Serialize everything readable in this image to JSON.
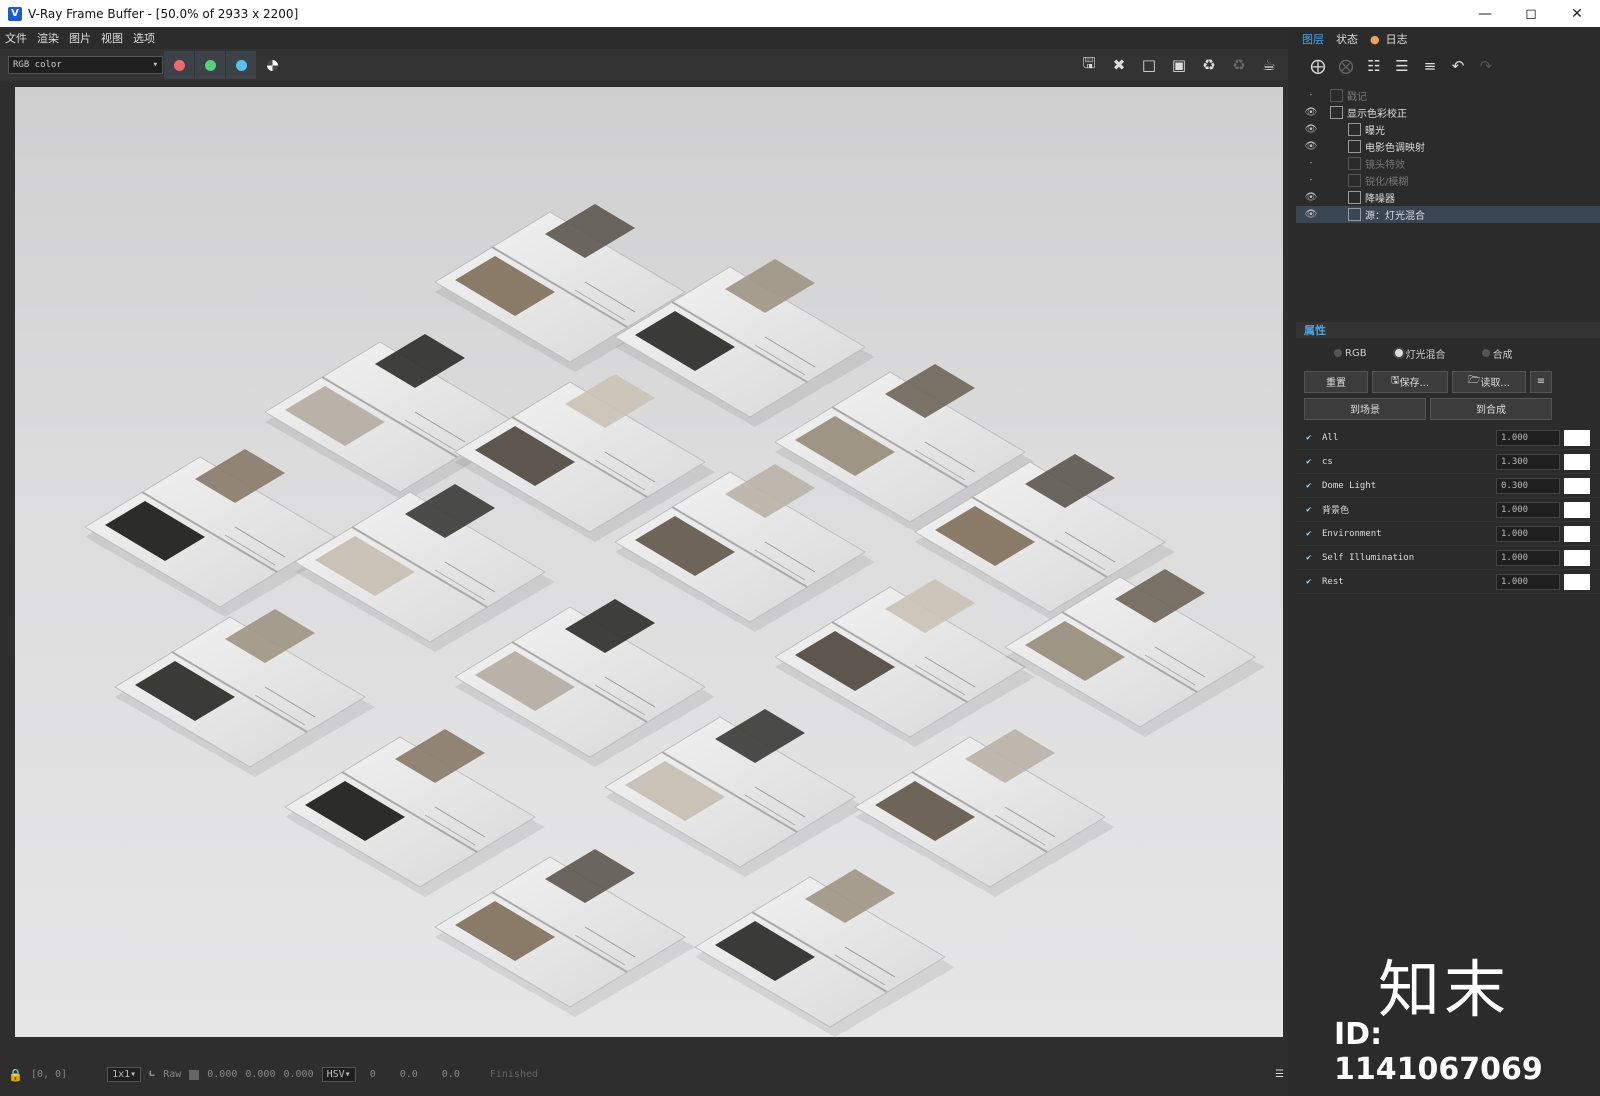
{
  "window": {
    "title": "V-Ray Frame Buffer - [50.0% of 2933 x 2200]",
    "app_icon": "V"
  },
  "menu": [
    "文件",
    "渲染",
    "图片",
    "视图",
    "选项"
  ],
  "toolbar": {
    "channel": "RGB color",
    "colors": {
      "red": "#f06a6a",
      "green": "#58d07a",
      "blue": "#5bc0f0"
    }
  },
  "right_tabs": [
    "图层",
    "状态",
    "日志"
  ],
  "layers": [
    {
      "label": "戳记",
      "visible": false,
      "dim": true
    },
    {
      "label": "显示色彩校正",
      "visible": true,
      "dim": false
    },
    {
      "label": "曝光",
      "visible": true,
      "dim": false
    },
    {
      "label": "电影色调映射",
      "visible": true,
      "dim": false
    },
    {
      "label": "镜头特效",
      "visible": false,
      "dim": true
    },
    {
      "label": "锐化/模糊",
      "visible": false,
      "dim": true
    },
    {
      "label": "降噪器",
      "visible": true,
      "dim": false
    },
    {
      "label": "源：灯光混合",
      "visible": true,
      "dim": false,
      "selected": true
    }
  ],
  "properties": {
    "header": "属性",
    "modes": [
      "RGB",
      "灯光混合",
      "合成"
    ],
    "buttons": {
      "reset": "重置",
      "save": "保存...",
      "load": "读取...",
      "to_scene": "到场景",
      "to_comp": "到合成"
    }
  },
  "light_mix": [
    {
      "name": "All",
      "value": "1.000"
    },
    {
      "name": "cs",
      "value": "1.300"
    },
    {
      "name": "Dome Light",
      "value": "0.300"
    },
    {
      "name": "背景色",
      "value": "1.000"
    },
    {
      "name": "Environment",
      "value": "1.000"
    },
    {
      "name": "Self Illumination",
      "value": "1.000"
    },
    {
      "name": "Rest",
      "value": "1.000"
    }
  ],
  "status": {
    "coords": "[0, 0]",
    "zoom": "1x1",
    "raw": "Raw",
    "rgb": [
      "0.000",
      "0.000",
      "0.000"
    ],
    "mode": "HSV",
    "hsv": [
      "0",
      "0.0",
      "0.0"
    ],
    "state": "Finished"
  },
  "watermark": {
    "brand": "知末",
    "id": "ID: 1141067069"
  }
}
